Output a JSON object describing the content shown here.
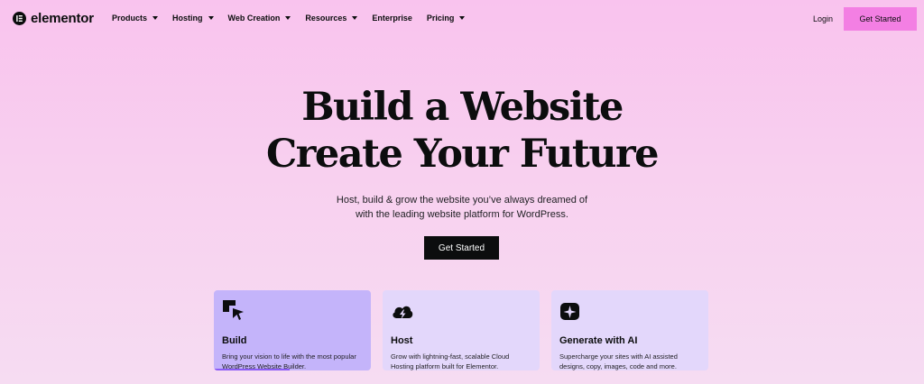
{
  "nav": {
    "brand": "elementor",
    "menu": [
      {
        "label": "Products",
        "dropdown": true
      },
      {
        "label": "Hosting",
        "dropdown": true
      },
      {
        "label": "Web Creation",
        "dropdown": true
      },
      {
        "label": "Resources",
        "dropdown": true
      },
      {
        "label": "Enterprise",
        "dropdown": false
      },
      {
        "label": "Pricing",
        "dropdown": true
      }
    ],
    "login": "Login",
    "cta": "Get Started"
  },
  "hero": {
    "title_line1": "Build a Website",
    "title_line2": "Create Your Future",
    "subtitle_line1": "Host, build & grow the website you’ve always dreamed of",
    "subtitle_line2": "with the leading website platform for WordPress.",
    "cta": "Get Started"
  },
  "cards": [
    {
      "icon": "build-cursor-icon",
      "title": "Build",
      "desc_line1": "Bring your vision to life with the most popular",
      "desc_line2": "WordPress Website Builder.",
      "active": true,
      "progress": 0.48
    },
    {
      "icon": "cloud-lightning-icon",
      "title": "Host",
      "desc_line1": "Grow with lightning-fast, scalable Cloud",
      "desc_line2": "Hosting platform built for Elementor.",
      "active": false
    },
    {
      "icon": "ai-sparkle-icon",
      "title": "Generate with AI",
      "desc_line1": "Supercharge your sites with AI assisted",
      "desc_line2": "designs, copy, images, code and more.",
      "active": false
    }
  ],
  "colors": {
    "accent_pink": "#f37fe3",
    "card_bg": "#e3d7fb",
    "card_active_bg": "#c4b4fa",
    "progress": "#8b5cf6"
  }
}
